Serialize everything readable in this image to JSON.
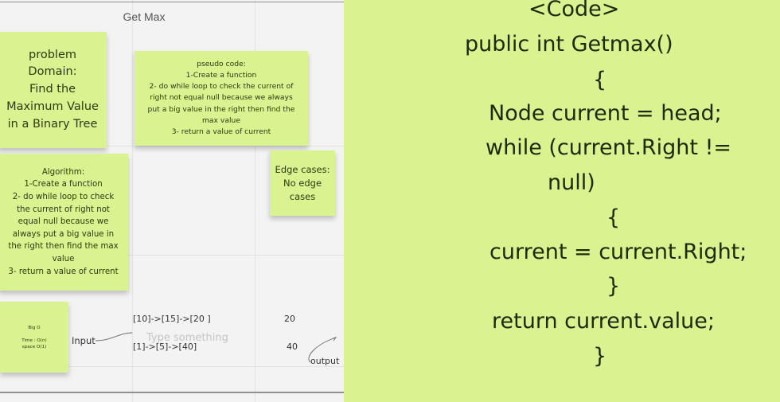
{
  "board": {
    "frame_title": "Get Max"
  },
  "notes": {
    "problem": "problem\nDomain:\nFind the\nMaximum Value\nin a Binary Tree",
    "pseudo": "pseudo code:\n1-Create a function\n2- do while loop to check the current of\nright not equal null because we always\nput a big value in the right then find the\nmax value\n3- return a value of current",
    "algorithm": "Algorithm:\n1-Create a function\n2- do while loop to check\nthe current of right not\nequal null because we\nalways put a big value in\nthe right then find the max\nvalue\n3- return a value of current",
    "edge": "Edge cases:\nNo edge\ncases",
    "big_o": "Big O\n\nTime : O(n)\nspace O(1)"
  },
  "io": {
    "input_label": "Input",
    "input_1": "[10]->[15]->[20 ]",
    "input_2": "[1]->[5]->[40]",
    "output_1": "20",
    "output_2": "40",
    "output_label": "output",
    "type_placeholder": "Type something"
  },
  "code": {
    "lines": [
      "<Code>",
      "public int Getmax()",
      "{",
      "Node current = head;",
      "while (current.Right !=",
      "null)",
      "{",
      "current = current.Right;",
      "}",
      "return current.value;",
      "}"
    ]
  },
  "colors": {
    "sticky": "#d8f38f",
    "board": "#f3f3f3"
  }
}
